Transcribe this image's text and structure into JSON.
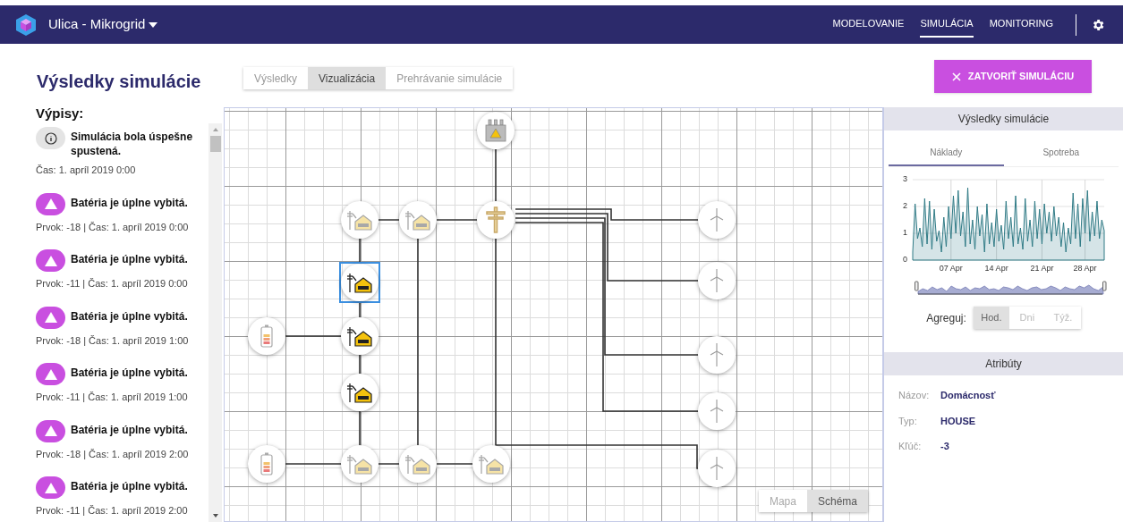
{
  "app": {
    "title": "Ulica - Mikrogrid"
  },
  "nav": [
    {
      "label": "MODELOVANIE",
      "selected": false
    },
    {
      "label": "SIMULÁCIA",
      "selected": true
    },
    {
      "label": "MONITORING",
      "selected": false
    }
  ],
  "page_title": "Výsledky simulácie",
  "view_tabs": [
    {
      "label": "Výsledky",
      "selected": false
    },
    {
      "label": "Vizualizácia",
      "selected": true
    },
    {
      "label": "Prehrávanie simulácie",
      "selected": false
    }
  ],
  "close_button": "ZATVORIŤ SIMULÁCIU",
  "log": {
    "heading": "Výpisy:",
    "items": [
      {
        "kind": "info",
        "title": "Simulácia bola úspešne spustená.",
        "detail": "Čas: 1. apríl 2019 0:00"
      },
      {
        "kind": "warning",
        "title": "Batéria je úplne vybitá.",
        "detail": "Prvok: -18 | Čas: 1. apríl 2019 0:00"
      },
      {
        "kind": "warning",
        "title": "Batéria je úplne vybitá.",
        "detail": "Prvok: -11 | Čas: 1. apríl 2019 0:00"
      },
      {
        "kind": "warning",
        "title": "Batéria je úplne vybitá.",
        "detail": "Prvok: -18 | Čas: 1. apríl 2019 1:00"
      },
      {
        "kind": "warning",
        "title": "Batéria je úplne vybitá.",
        "detail": "Prvok: -11 | Čas: 1. apríl 2019 1:00"
      },
      {
        "kind": "warning",
        "title": "Batéria je úplne vybitá.",
        "detail": "Prvok: -18 | Čas: 1. apríl 2019 2:00"
      },
      {
        "kind": "warning",
        "title": "Batéria je úplne vybitá.",
        "detail": "Prvok: -11 | Čas: 1. apríl 2019 2:00"
      }
    ]
  },
  "diagram": {
    "nodes": [
      {
        "kind": "transformer",
        "selected": false
      },
      {
        "kind": "pole",
        "selected": false
      },
      {
        "kind": "house",
        "powered": false,
        "selected": false
      },
      {
        "kind": "house",
        "powered": false,
        "selected": false
      },
      {
        "kind": "house",
        "powered": true,
        "selected": true
      },
      {
        "kind": "battery",
        "selected": false
      },
      {
        "kind": "house",
        "powered": true,
        "selected": false
      },
      {
        "kind": "house",
        "powered": true,
        "selected": false
      },
      {
        "kind": "battery",
        "selected": false
      },
      {
        "kind": "house",
        "powered": false,
        "selected": false
      },
      {
        "kind": "house",
        "powered": false,
        "selected": false
      },
      {
        "kind": "house",
        "powered": false,
        "selected": false
      },
      {
        "kind": "turbine",
        "selected": false
      },
      {
        "kind": "turbine",
        "selected": false
      },
      {
        "kind": "turbine",
        "selected": false
      },
      {
        "kind": "turbine",
        "selected": false
      },
      {
        "kind": "turbine",
        "selected": false
      }
    ],
    "view_toggle": [
      {
        "label": "Mapa",
        "selected": false
      },
      {
        "label": "Schéma",
        "selected": true
      }
    ]
  },
  "results_panel": {
    "title": "Výsledky simulácie",
    "tabs": [
      {
        "label": "Náklady",
        "selected": true
      },
      {
        "label": "Spotreba",
        "selected": false
      }
    ],
    "chart_data": {
      "type": "area",
      "categories": [
        null,
        null,
        null,
        null,
        null,
        null,
        null,
        null,
        null,
        null,
        null,
        null,
        null,
        null,
        null,
        null,
        "07 Apr",
        null,
        null,
        null,
        null,
        null,
        null,
        null,
        null,
        null,
        null,
        null,
        null,
        null,
        null,
        null,
        null,
        null,
        null,
        "14 Apr",
        null,
        null,
        null,
        null,
        null,
        null,
        null,
        null,
        null,
        null,
        null,
        null,
        null,
        null,
        null,
        null,
        null,
        null,
        "21 Apr",
        null,
        null,
        null,
        null,
        null,
        null,
        null,
        null,
        null,
        null,
        null,
        null,
        null,
        null,
        null,
        null,
        null,
        "28 Apr",
        null,
        null,
        null,
        null,
        null,
        null,
        null,
        null
      ],
      "ylim": [
        0,
        3
      ],
      "yticks": [
        0,
        1,
        2,
        3
      ],
      "series": [
        {
          "color": "#2f7a85",
          "values": [
            0.3,
            2.1,
            0.8,
            1.2,
            0.5,
            2.3,
            0.6,
            2.2,
            0.4,
            1.9,
            0.7,
            1.1,
            0.3,
            1.6,
            0.5,
            2.0,
            0.8,
            2.4,
            1.0,
            2.6,
            0.9,
            1.8,
            0.5,
            2.7,
            0.6,
            1.5,
            0.4,
            2.0,
            0.9,
            1.7,
            0.3,
            2.1,
            0.6,
            1.4,
            0.5,
            1.9,
            0.7,
            1.3,
            0.4,
            2.2,
            0.8,
            1.6,
            0.5,
            2.4,
            0.6,
            1.2,
            0.4,
            2.3,
            0.7,
            1.5,
            0.5,
            2.2,
            0.8,
            1.9,
            0.6,
            2.1,
            1.0,
            1.8,
            0.7,
            2.0,
            0.9,
            1.6,
            0.5,
            1.4,
            0.3,
            1.2,
            0.6,
            2.5,
            0.8,
            2.1,
            0.5,
            2.3,
            1.0,
            2.6,
            0.7,
            1.8,
            0.9,
            2.2,
            0.8,
            1.5,
            1.1
          ]
        }
      ]
    },
    "aggregate": {
      "label": "Agreguj:",
      "options": [
        {
          "label": "Hod.",
          "selected": true
        },
        {
          "label": "Dni",
          "selected": false
        },
        {
          "label": "Týž.",
          "selected": false
        }
      ]
    }
  },
  "attributes": {
    "title": "Atribúty",
    "rows": [
      {
        "label": "Názov:",
        "value": "Domácnosť"
      },
      {
        "label": "Typ:",
        "value": "HOUSE"
      },
      {
        "label": "Kľúč:",
        "value": "-3"
      }
    ]
  }
}
